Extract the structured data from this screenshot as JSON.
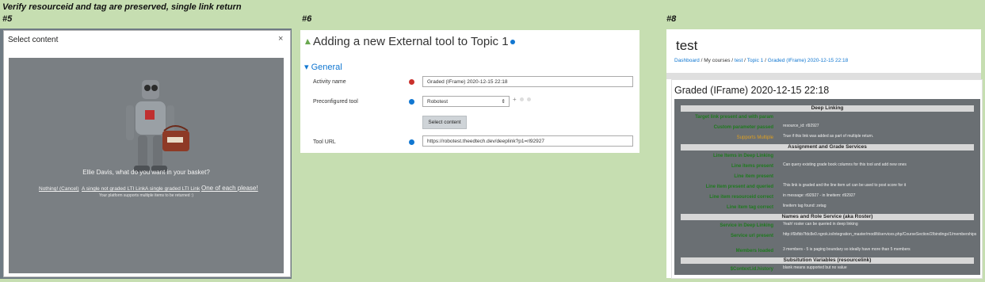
{
  "caption": "Verify resourceid and tag are preserved, single link return",
  "panel5": {
    "number": "#5",
    "modal_title": "Select content",
    "close": "×",
    "question": "Ellie Davis, what do you want in your basket?",
    "links": [
      "Nothing! (Cancel)",
      "A single not graded LTI Link",
      "A single graded LTI Link",
      "One of each please!"
    ],
    "note": "Your platform supports multiple items to be returned :)"
  },
  "panel6": {
    "number": "#6",
    "title": "Adding a new External tool to Topic 1",
    "section": "General",
    "fields": {
      "activity_name_label": "Activity name",
      "activity_name_value": "Graded (IFrame) 2020-12-15 22:18",
      "preconfigured_label": "Preconfigured tool",
      "preconfigured_value": "Robotest",
      "select_button": "Select content",
      "url_label": "Tool URL",
      "url_value": "https://robotest.theedtech.dev/deeplink?p1=rl92927"
    }
  },
  "panel8": {
    "number": "#8",
    "title": "test",
    "breadcrumb": [
      "Dashboard",
      "My courses",
      "test",
      "Topic 1",
      "Graded (IFrame) 2020-12-15 22:18"
    ],
    "subtitle": "Graded (IFrame) 2020-12-15 22:18",
    "sections": [
      {
        "header": "Deep Linking",
        "rows": [
          {
            "k": "Target link present and with param",
            "v": ""
          },
          {
            "k": "Custom parameter passed",
            "v": "resource_id: rl92927"
          },
          {
            "k": "Supports Multiple",
            "v": "True if this link was added as part of multiple return."
          }
        ]
      },
      {
        "header": "Assignment and Grade Services",
        "rows": [
          {
            "k": "Line Items in Deep Linking",
            "v": ""
          },
          {
            "k": "Line items present",
            "v": "Can query existing grade book columns for this tool and add new ones"
          },
          {
            "k": "Line item present",
            "v": ""
          },
          {
            "k": "Line item present and queried",
            "v": "This link is graded and the line item url can be used to post score for it"
          },
          {
            "k": "Line item resourceid correct",
            "v": "in message: rl92927 - in lineitem: rl92927"
          },
          {
            "k": "Line item tag correct",
            "v": "lineitem tag found: zetag"
          }
        ]
      },
      {
        "header": "Names and Role Service (aka Roster)",
        "rows": [
          {
            "k": "Service in Deep Linking",
            "v": "Yeah! roster can be queried in deep linking"
          },
          {
            "k": "Service url present",
            "v": "http://6bfbb7fdc8e0.ngrok.io/integration_master/mod/lti/services.php/CourseSection/2/bindings/1/memberships"
          },
          {
            "k": "Members loaded",
            "v": "3 members - 5 is paging boundary so ideally have more than 5 members"
          }
        ]
      },
      {
        "header": "Subsitution Variables (resourcelink)",
        "rows": [
          {
            "k": "$Context.id.history",
            "v": "blank means supported but no value"
          }
        ]
      }
    ]
  },
  "colors": {
    "background": "#c6deb1",
    "accent": "#1177d1",
    "success": "#1e7a1e",
    "warning": "#e0a020",
    "error": "#c9302c"
  }
}
